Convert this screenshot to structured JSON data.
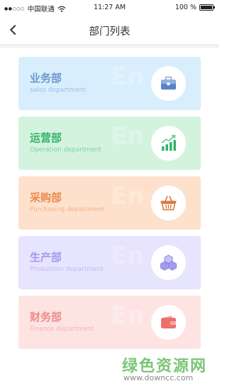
{
  "status_bar": {
    "carrier": "中国联通",
    "time": "11:27 AM",
    "battery": "100 %",
    "battery_level": 1.0
  },
  "nav": {
    "title": "部门列表"
  },
  "departments": [
    {
      "name": "业务部",
      "subtitle": "sales department",
      "icon": "briefcase-icon",
      "color": "#6d98d2"
    },
    {
      "name": "运营部",
      "subtitle": "Operation department",
      "icon": "bar-chart-icon",
      "color": "#35b46c"
    },
    {
      "name": "采购部",
      "subtitle": "Purchasing department",
      "icon": "basket-icon",
      "color": "#eb8c4c"
    },
    {
      "name": "生产部",
      "subtitle": "Production department",
      "icon": "cubes-icon",
      "color": "#a59aef"
    },
    {
      "name": "财务部",
      "subtitle": "Finance department",
      "icon": "wallet-icon",
      "color": "#ee8c8a"
    }
  ],
  "watermark": {
    "title": "绿色资源网",
    "url": "www.downcc.com"
  }
}
